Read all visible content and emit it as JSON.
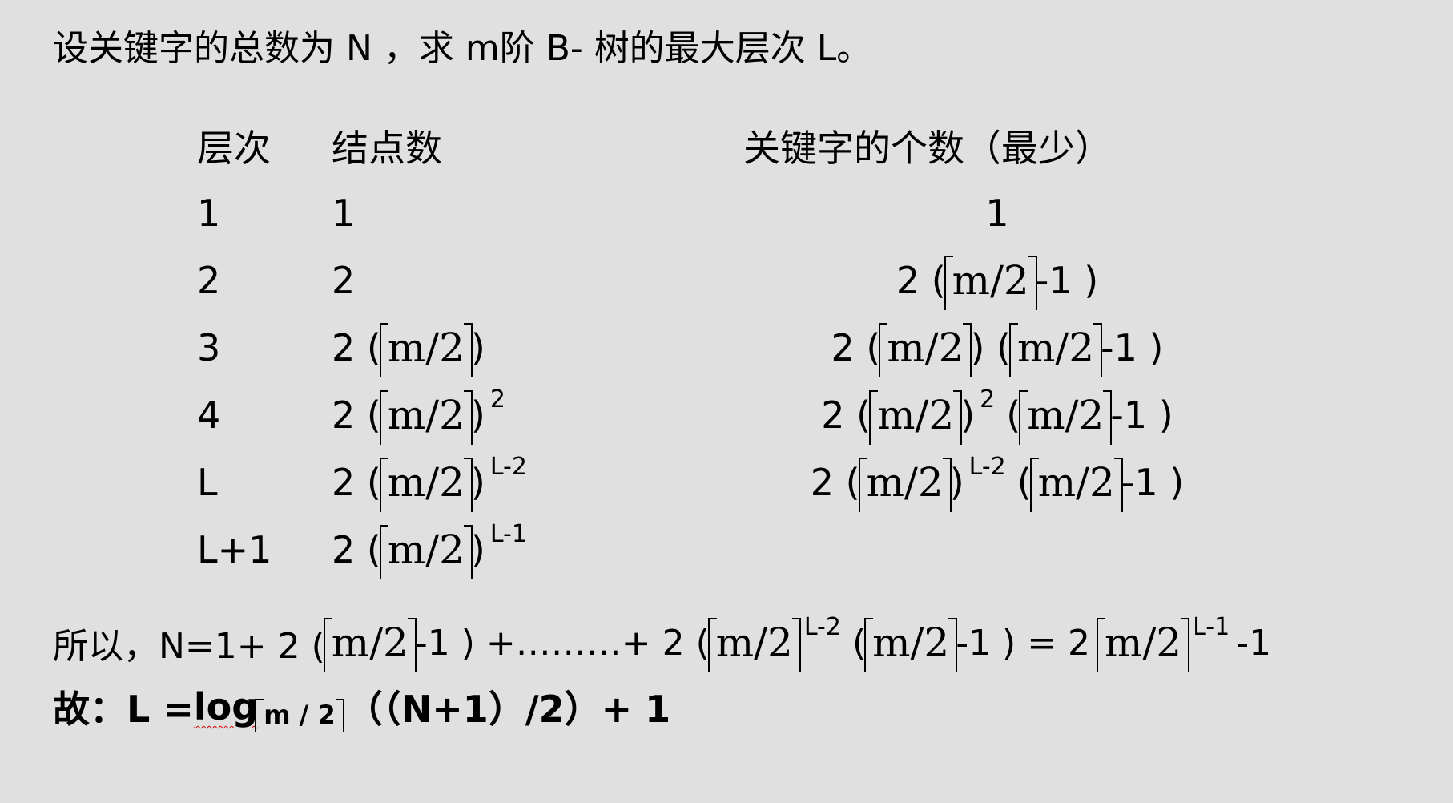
{
  "title": "设关键字的总数为 N ，求 m阶 B- 树的最大层次 L。",
  "table": {
    "headers": [
      "层次",
      "结点数",
      "关键字的个数（最少）"
    ],
    "ceil_expr": "m/2",
    "rows": [
      {
        "level": "1",
        "nodes_pre": "1",
        "keys_plain": "1"
      },
      {
        "level": "2",
        "nodes_pre": "2",
        "keys_pre": "2 (",
        "keys_post": "-1 )"
      },
      {
        "level": "3",
        "nodes_pre": "2 (",
        "nodes_post": ")",
        "keys_pre": "2 (",
        "keys_mid": ")  (",
        "keys_post": "-1 )"
      },
      {
        "level": "4",
        "nodes_pre": "2 (",
        "nodes_post": ")",
        "nodes_exp": "2",
        "keys_pre": "2 (",
        "keys_mid": ")",
        "keys_exp": "2",
        "keys_mid2": "(",
        "keys_post": "-1 )"
      },
      {
        "level": "L",
        "nodes_pre": "2 (",
        "nodes_post": ")",
        "nodes_exp": "L-2",
        "keys_pre": "2 (",
        "keys_mid": ")",
        "keys_exp": "L-2",
        "keys_mid2": "(",
        "keys_post": "-1 )"
      },
      {
        "level": "L+1",
        "nodes_pre": "2 (",
        "nodes_post": ")",
        "nodes_exp": "L-1"
      }
    ]
  },
  "sum_line": {
    "prefix": "所以，N=1+  2 (",
    "part2": "-1 )  +………+ 2 (",
    "exp1": "L-2",
    "part3": "(",
    "part4": "-1 )  = 2",
    "exp2": "L-1",
    "suffix": "-1"
  },
  "result_line": {
    "prefix": "故：L = ",
    "log": "log",
    "base": "m / 2",
    "suffix": "（（N+1）/2）+ 1"
  }
}
